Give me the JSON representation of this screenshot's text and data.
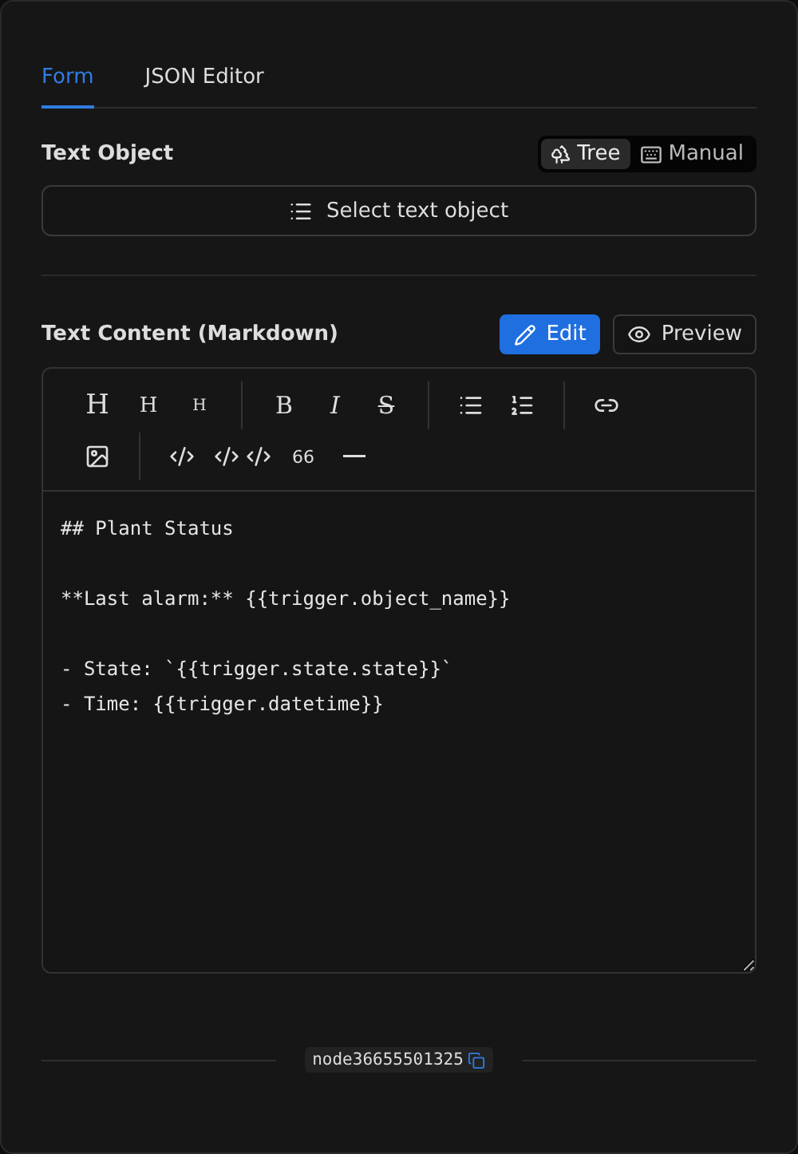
{
  "tabs": [
    {
      "label": "Form",
      "selected": true
    },
    {
      "label": "JSON Editor",
      "selected": false
    }
  ],
  "text_object": {
    "label": "Text Object",
    "modes": [
      {
        "label": "Tree",
        "kind": "tree",
        "selected": true
      },
      {
        "label": "Manual",
        "kind": "keyboard",
        "selected": false
      }
    ],
    "select_button": "Select text object"
  },
  "text_content": {
    "label": "Text Content (Markdown)",
    "modes": [
      {
        "label": "Edit",
        "kind": "pencil",
        "selected": true
      },
      {
        "label": "Preview",
        "kind": "eye",
        "selected": false
      }
    ],
    "toolbar": [
      [
        [
          {
            "kind": "h1",
            "label": "H"
          },
          {
            "kind": "h2",
            "label": "H"
          },
          {
            "kind": "h3",
            "label": "H"
          }
        ],
        [
          {
            "kind": "bold",
            "label": "B"
          },
          {
            "kind": "italic",
            "label": "I"
          },
          {
            "kind": "strike",
            "label": "S"
          }
        ],
        [
          {
            "kind": "bullets"
          },
          {
            "kind": "numbers"
          }
        ],
        [
          {
            "kind": "link"
          }
        ]
      ],
      [
        [
          {
            "kind": "image"
          }
        ],
        [
          {
            "kind": "code"
          },
          {
            "kind": "codeblock"
          },
          {
            "kind": "quote",
            "label": "66"
          },
          {
            "kind": "rule"
          }
        ]
      ]
    ],
    "value": "## Plant Status\n\n**Last alarm:** {{trigger.object_name}}\n\n- State: `{{trigger.state.state}}`\n- Time: {{trigger.datetime}}"
  },
  "footer": {
    "node_id": "node36655501325"
  }
}
